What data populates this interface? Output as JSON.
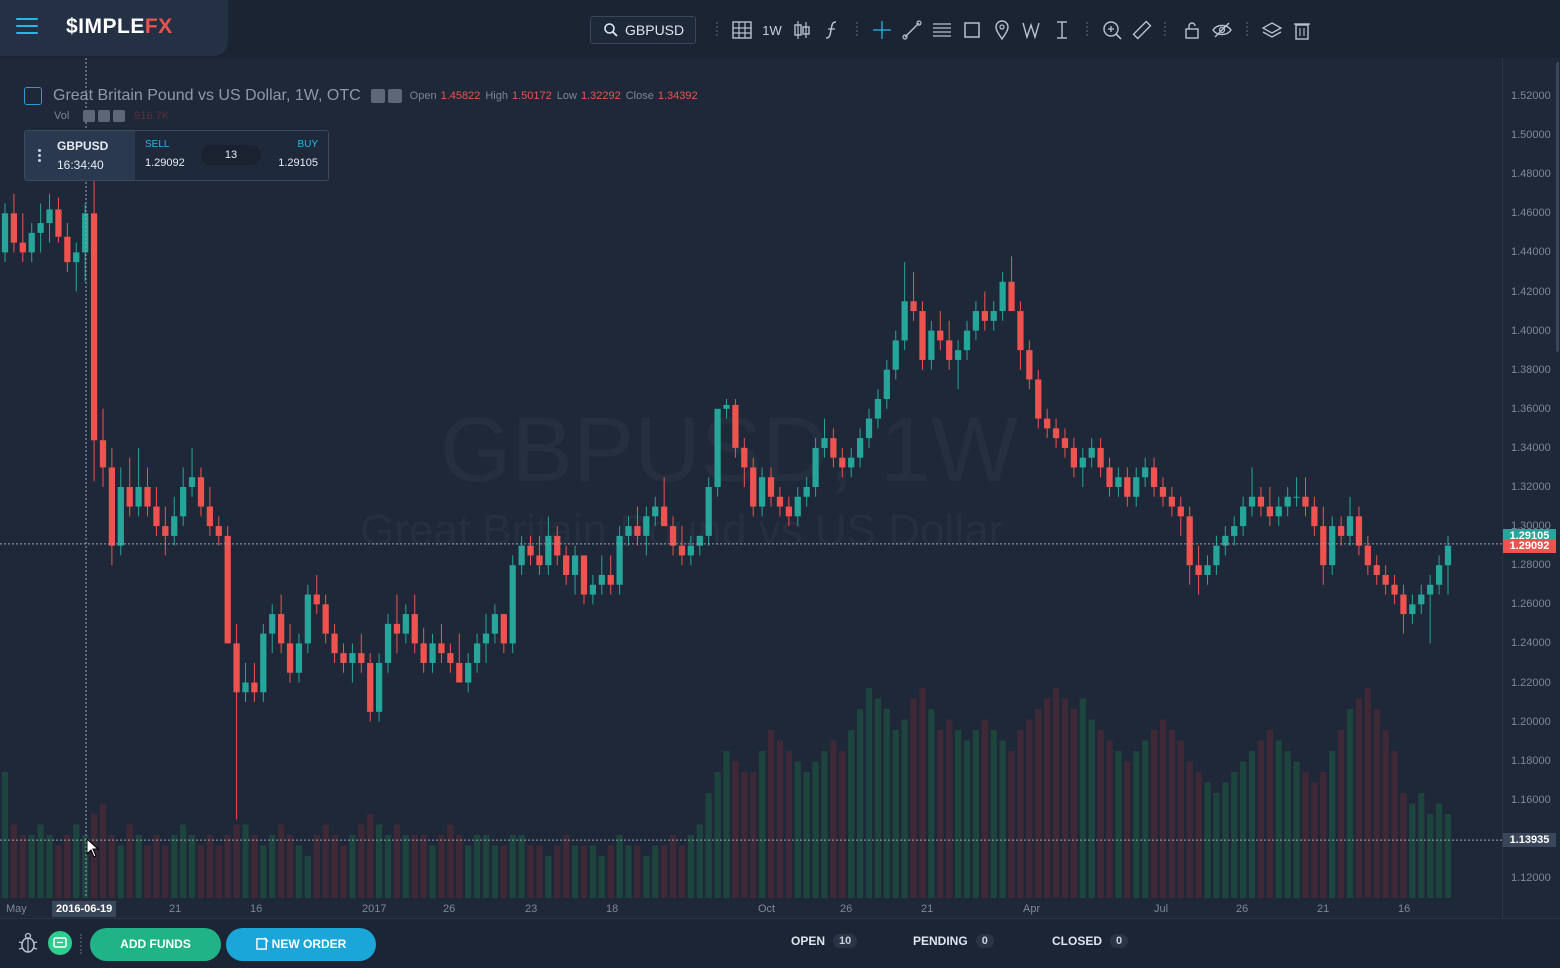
{
  "brand": {
    "logo_main": "$IMPLE",
    "logo_accent": "FX"
  },
  "toolbar": {
    "symbol": "GBPUSD",
    "interval": "1W",
    "icons": [
      "grid-icon",
      "candles-icon",
      "indicators-icon",
      "crosshair-icon",
      "trend-line-icon",
      "fib-icon",
      "rectangle-icon",
      "pin-icon",
      "pattern-icon",
      "measure-icon",
      "zoom-in-icon",
      "ruler-icon",
      "lock-icon",
      "hide-icon",
      "layers-icon",
      "trash-icon"
    ]
  },
  "chart": {
    "watermark_symbol": "GBPUSD, 1W",
    "watermark_name": "Great Britain Pound vs US Dollar",
    "legend": {
      "title": "Great Britain Pound vs US Dollar, 1W, OTC",
      "open_label": "Open",
      "open": "1.45822",
      "high_label": "High",
      "high": "1.50172",
      "low_label": "Low",
      "low": "1.32292",
      "close_label": "Close",
      "close": "1.34392",
      "vol_label": "Vol",
      "vol_value": "916.7K"
    },
    "quote": {
      "symbol": "GBPUSD",
      "time": "16:34:40",
      "sell_label": "SELL",
      "sell": "1.29092",
      "buy_label": "BUY",
      "buy": "1.29105",
      "spread": "13"
    },
    "price_labels": [
      "1.52000",
      "1.50000",
      "1.48000",
      "1.46000",
      "1.44000",
      "1.42000",
      "1.40000",
      "1.38000",
      "1.36000",
      "1.34000",
      "1.32000",
      "1.30000",
      "1.28000",
      "1.26000",
      "1.24000",
      "1.22000",
      "1.20000",
      "1.18000",
      "1.16000",
      "1.14000",
      "1.12000"
    ],
    "buy_tag": "1.29105",
    "sell_tag": "1.29092",
    "cursor_price_tag": "1.13935",
    "cursor_date": "2016-06-19",
    "time_labels": [
      "May",
      "21",
      "16",
      "2017",
      "26",
      "23",
      "18",
      "Oct",
      "26",
      "21",
      "Apr",
      "Jul",
      "26",
      "21",
      "16"
    ],
    "colors": {
      "up": "#26a69a",
      "down": "#ef5350",
      "accent": "#29b6e8"
    }
  },
  "chart_data": {
    "type": "candlestick",
    "title": "Great Britain Pound vs US Dollar, 1W, OTC",
    "ylim": [
      1.11,
      1.53
    ],
    "candles": [
      [
        1.44,
        1.465,
        1.435,
        1.46
      ],
      [
        1.46,
        1.47,
        1.44,
        1.445
      ],
      [
        1.445,
        1.46,
        1.435,
        1.44
      ],
      [
        1.44,
        1.455,
        1.435,
        1.45
      ],
      [
        1.45,
        1.465,
        1.44,
        1.455
      ],
      [
        1.455,
        1.47,
        1.445,
        1.462
      ],
      [
        1.462,
        1.468,
        1.445,
        1.448
      ],
      [
        1.448,
        1.455,
        1.43,
        1.435
      ],
      [
        1.435,
        1.445,
        1.42,
        1.44
      ],
      [
        1.44,
        1.465,
        1.425,
        1.46
      ],
      [
        1.46,
        1.5017,
        1.3229,
        1.3439
      ],
      [
        1.3439,
        1.36,
        1.32,
        1.33
      ],
      [
        1.33,
        1.34,
        1.28,
        1.29
      ],
      [
        1.29,
        1.33,
        1.285,
        1.32
      ],
      [
        1.32,
        1.335,
        1.305,
        1.31
      ],
      [
        1.31,
        1.34,
        1.305,
        1.32
      ],
      [
        1.32,
        1.33,
        1.305,
        1.31
      ],
      [
        1.31,
        1.32,
        1.295,
        1.3
      ],
      [
        1.3,
        1.31,
        1.285,
        1.295
      ],
      [
        1.295,
        1.315,
        1.29,
        1.305
      ],
      [
        1.305,
        1.33,
        1.3,
        1.32
      ],
      [
        1.32,
        1.34,
        1.315,
        1.325
      ],
      [
        1.325,
        1.33,
        1.305,
        1.31
      ],
      [
        1.31,
        1.32,
        1.295,
        1.3
      ],
      [
        1.3,
        1.305,
        1.29,
        1.295
      ],
      [
        1.295,
        1.3,
        1.28,
        1.24
      ],
      [
        1.24,
        1.25,
        1.15,
        1.215
      ],
      [
        1.215,
        1.23,
        1.21,
        1.22
      ],
      [
        1.22,
        1.23,
        1.21,
        1.215
      ],
      [
        1.215,
        1.25,
        1.21,
        1.245
      ],
      [
        1.245,
        1.26,
        1.235,
        1.255
      ],
      [
        1.255,
        1.265,
        1.235,
        1.24
      ],
      [
        1.24,
        1.25,
        1.22,
        1.225
      ],
      [
        1.225,
        1.245,
        1.22,
        1.24
      ],
      [
        1.24,
        1.27,
        1.235,
        1.265
      ],
      [
        1.265,
        1.275,
        1.255,
        1.26
      ],
      [
        1.26,
        1.265,
        1.24,
        1.245
      ],
      [
        1.245,
        1.25,
        1.23,
        1.235
      ],
      [
        1.235,
        1.24,
        1.225,
        1.23
      ],
      [
        1.23,
        1.24,
        1.22,
        1.235
      ],
      [
        1.235,
        1.245,
        1.225,
        1.23
      ],
      [
        1.23,
        1.235,
        1.2,
        1.205
      ],
      [
        1.205,
        1.235,
        1.2,
        1.23
      ],
      [
        1.23,
        1.255,
        1.225,
        1.25
      ],
      [
        1.25,
        1.265,
        1.235,
        1.245
      ],
      [
        1.245,
        1.26,
        1.24,
        1.255
      ],
      [
        1.255,
        1.265,
        1.235,
        1.24
      ],
      [
        1.24,
        1.248,
        1.225,
        1.23
      ],
      [
        1.23,
        1.245,
        1.225,
        1.24
      ],
      [
        1.24,
        1.25,
        1.23,
        1.235
      ],
      [
        1.235,
        1.24,
        1.225,
        1.23
      ],
      [
        1.23,
        1.245,
        1.22,
        1.22
      ],
      [
        1.22,
        1.235,
        1.215,
        1.23
      ],
      [
        1.23,
        1.245,
        1.225,
        1.24
      ],
      [
        1.24,
        1.255,
        1.23,
        1.245
      ],
      [
        1.245,
        1.26,
        1.24,
        1.255
      ],
      [
        1.255,
        1.255,
        1.235,
        1.24
      ],
      [
        1.24,
        1.285,
        1.235,
        1.28
      ],
      [
        1.28,
        1.295,
        1.275,
        1.29
      ],
      [
        1.29,
        1.295,
        1.28,
        1.285
      ],
      [
        1.285,
        1.295,
        1.275,
        1.28
      ],
      [
        1.28,
        1.305,
        1.275,
        1.295
      ],
      [
        1.295,
        1.3,
        1.28,
        1.285
      ],
      [
        1.285,
        1.29,
        1.27,
        1.275
      ],
      [
        1.275,
        1.29,
        1.265,
        1.285
      ],
      [
        1.285,
        1.285,
        1.26,
        1.265
      ],
      [
        1.265,
        1.275,
        1.26,
        1.27
      ],
      [
        1.27,
        1.285,
        1.265,
        1.275
      ],
      [
        1.275,
        1.285,
        1.265,
        1.27
      ],
      [
        1.27,
        1.3,
        1.265,
        1.295
      ],
      [
        1.295,
        1.305,
        1.29,
        1.3
      ],
      [
        1.3,
        1.31,
        1.29,
        1.295
      ],
      [
        1.295,
        1.31,
        1.285,
        1.305
      ],
      [
        1.305,
        1.315,
        1.3,
        1.31
      ],
      [
        1.31,
        1.325,
        1.3,
        1.3
      ],
      [
        1.3,
        1.305,
        1.285,
        1.29
      ],
      [
        1.29,
        1.3,
        1.28,
        1.285
      ],
      [
        1.285,
        1.295,
        1.28,
        1.29
      ],
      [
        1.29,
        1.295,
        1.285,
        1.295
      ],
      [
        1.295,
        1.325,
        1.29,
        1.32
      ],
      [
        1.32,
        1.35,
        1.315,
        1.36
      ],
      [
        1.36,
        1.365,
        1.355,
        1.362
      ],
      [
        1.362,
        1.365,
        1.335,
        1.34
      ],
      [
        1.34,
        1.345,
        1.32,
        1.33
      ],
      [
        1.33,
        1.335,
        1.305,
        1.31
      ],
      [
        1.31,
        1.33,
        1.305,
        1.325
      ],
      [
        1.325,
        1.33,
        1.31,
        1.315
      ],
      [
        1.315,
        1.32,
        1.305,
        1.31
      ],
      [
        1.31,
        1.315,
        1.3,
        1.305
      ],
      [
        1.305,
        1.32,
        1.3,
        1.315
      ],
      [
        1.315,
        1.325,
        1.31,
        1.32
      ],
      [
        1.32,
        1.345,
        1.315,
        1.34
      ],
      [
        1.34,
        1.355,
        1.335,
        1.345
      ],
      [
        1.345,
        1.35,
        1.33,
        1.335
      ],
      [
        1.335,
        1.34,
        1.325,
        1.33
      ],
      [
        1.33,
        1.34,
        1.325,
        1.335
      ],
      [
        1.335,
        1.35,
        1.33,
        1.345
      ],
      [
        1.345,
        1.36,
        1.34,
        1.355
      ],
      [
        1.355,
        1.37,
        1.35,
        1.365
      ],
      [
        1.365,
        1.385,
        1.36,
        1.38
      ],
      [
        1.38,
        1.4,
        1.375,
        1.395
      ],
      [
        1.395,
        1.435,
        1.39,
        1.415
      ],
      [
        1.415,
        1.43,
        1.405,
        1.41
      ],
      [
        1.41,
        1.415,
        1.38,
        1.385
      ],
      [
        1.385,
        1.405,
        1.38,
        1.4
      ],
      [
        1.4,
        1.41,
        1.39,
        1.395
      ],
      [
        1.395,
        1.405,
        1.38,
        1.385
      ],
      [
        1.385,
        1.395,
        1.37,
        1.39
      ],
      [
        1.39,
        1.405,
        1.385,
        1.4
      ],
      [
        1.4,
        1.415,
        1.395,
        1.41
      ],
      [
        1.41,
        1.42,
        1.4,
        1.405
      ],
      [
        1.405,
        1.415,
        1.4,
        1.41
      ],
      [
        1.41,
        1.43,
        1.405,
        1.425
      ],
      [
        1.425,
        1.438,
        1.41,
        1.41
      ],
      [
        1.41,
        1.415,
        1.38,
        1.39
      ],
      [
        1.39,
        1.395,
        1.37,
        1.375
      ],
      [
        1.375,
        1.38,
        1.35,
        1.355
      ],
      [
        1.355,
        1.36,
        1.345,
        1.35
      ],
      [
        1.35,
        1.355,
        1.34,
        1.345
      ],
      [
        1.345,
        1.35,
        1.335,
        1.34
      ],
      [
        1.34,
        1.345,
        1.325,
        1.33
      ],
      [
        1.33,
        1.34,
        1.32,
        1.335
      ],
      [
        1.335,
        1.345,
        1.33,
        1.34
      ],
      [
        1.34,
        1.345,
        1.325,
        1.33
      ],
      [
        1.33,
        1.335,
        1.315,
        1.32
      ],
      [
        1.32,
        1.33,
        1.315,
        1.325
      ],
      [
        1.325,
        1.33,
        1.31,
        1.315
      ],
      [
        1.315,
        1.33,
        1.31,
        1.325
      ],
      [
        1.325,
        1.335,
        1.32,
        1.33
      ],
      [
        1.33,
        1.335,
        1.315,
        1.32
      ],
      [
        1.32,
        1.325,
        1.31,
        1.315
      ],
      [
        1.315,
        1.32,
        1.305,
        1.31
      ],
      [
        1.31,
        1.315,
        1.295,
        1.305
      ],
      [
        1.305,
        1.31,
        1.27,
        1.28
      ],
      [
        1.28,
        1.29,
        1.265,
        1.275
      ],
      [
        1.275,
        1.285,
        1.27,
        1.28
      ],
      [
        1.28,
        1.295,
        1.275,
        1.29
      ],
      [
        1.29,
        1.3,
        1.285,
        1.295
      ],
      [
        1.295,
        1.305,
        1.29,
        1.3
      ],
      [
        1.3,
        1.315,
        1.295,
        1.31
      ],
      [
        1.31,
        1.33,
        1.305,
        1.315
      ],
      [
        1.315,
        1.32,
        1.305,
        1.31
      ],
      [
        1.31,
        1.32,
        1.3,
        1.305
      ],
      [
        1.305,
        1.315,
        1.3,
        1.31
      ],
      [
        1.31,
        1.32,
        1.305,
        1.315
      ],
      [
        1.315,
        1.325,
        1.31,
        1.315
      ],
      [
        1.315,
        1.325,
        1.305,
        1.31
      ],
      [
        1.31,
        1.315,
        1.295,
        1.3
      ],
      [
        1.3,
        1.31,
        1.27,
        1.28
      ],
      [
        1.28,
        1.305,
        1.275,
        1.3
      ],
      [
        1.3,
        1.305,
        1.29,
        1.295
      ],
      [
        1.295,
        1.315,
        1.29,
        1.305
      ],
      [
        1.305,
        1.31,
        1.285,
        1.29
      ],
      [
        1.29,
        1.295,
        1.275,
        1.28
      ],
      [
        1.28,
        1.285,
        1.27,
        1.275
      ],
      [
        1.275,
        1.28,
        1.265,
        1.27
      ],
      [
        1.27,
        1.275,
        1.26,
        1.265
      ],
      [
        1.265,
        1.27,
        1.245,
        1.255
      ],
      [
        1.255,
        1.265,
        1.25,
        1.26
      ],
      [
        1.26,
        1.27,
        1.255,
        1.265
      ],
      [
        1.265,
        1.275,
        1.24,
        1.27
      ],
      [
        1.27,
        1.285,
        1.265,
        1.28
      ],
      [
        1.28,
        1.295,
        1.265,
        1.29
      ]
    ],
    "volume_relative": [
      0.6,
      0.35,
      0.3,
      0.3,
      0.35,
      0.3,
      0.25,
      0.3,
      0.35,
      0.3,
      0.4,
      0.45,
      0.3,
      0.25,
      0.35,
      0.3,
      0.25,
      0.3,
      0.25,
      0.3,
      0.35,
      0.3,
      0.25,
      0.3,
      0.25,
      0.3,
      0.35,
      0.35,
      0.3,
      0.25,
      0.3,
      0.35,
      0.3,
      0.25,
      0.2,
      0.3,
      0.35,
      0.3,
      0.25,
      0.3,
      0.35,
      0.4,
      0.35,
      0.3,
      0.35,
      0.3,
      0.3,
      0.3,
      0.25,
      0.3,
      0.35,
      0.3,
      0.25,
      0.3,
      0.3,
      0.25,
      0.25,
      0.3,
      0.3,
      0.25,
      0.25,
      0.2,
      0.25,
      0.3,
      0.25,
      0.25,
      0.25,
      0.2,
      0.25,
      0.3,
      0.25,
      0.25,
      0.2,
      0.25,
      0.25,
      0.3,
      0.25,
      0.3,
      0.35,
      0.5,
      0.6,
      0.7,
      0.65,
      0.6,
      0.6,
      0.7,
      0.8,
      0.75,
      0.7,
      0.65,
      0.6,
      0.65,
      0.7,
      0.75,
      0.7,
      0.8,
      0.9,
      1.0,
      0.95,
      0.9,
      0.8,
      0.85,
      0.95,
      1.0,
      0.9,
      0.8,
      0.85,
      0.8,
      0.75,
      0.8,
      0.85,
      0.8,
      0.75,
      0.7,
      0.8,
      0.85,
      0.9,
      0.95,
      1.0,
      0.95,
      0.9,
      0.95,
      0.85,
      0.8,
      0.75,
      0.7,
      0.65,
      0.7,
      0.75,
      0.8,
      0.85,
      0.8,
      0.75,
      0.65,
      0.6,
      0.55,
      0.5,
      0.55,
      0.6,
      0.65,
      0.7,
      0.75,
      0.8,
      0.75,
      0.7,
      0.65,
      0.6,
      0.55,
      0.6,
      0.7,
      0.8,
      0.9,
      0.95,
      1.0,
      0.9,
      0.8,
      0.7,
      0.5,
      0.45,
      0.5,
      0.4,
      0.45,
      0.4,
      0.45
    ]
  },
  "bottom": {
    "add_funds": "ADD FUNDS",
    "new_order": "NEW ORDER",
    "open_label": "OPEN",
    "open_count": "10",
    "pending_label": "PENDING",
    "pending_count": "0",
    "closed_label": "CLOSED",
    "closed_count": "0"
  }
}
